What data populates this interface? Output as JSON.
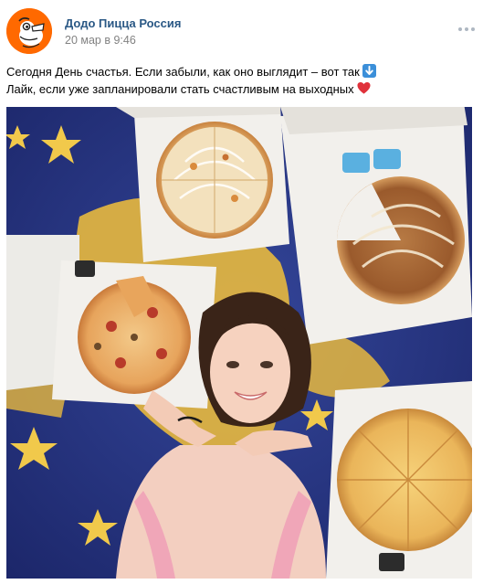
{
  "post": {
    "author": "Додо Пицца Россия",
    "date": "20 мар в 9:46",
    "text_line_1": "Сегодня День счастья. Если забыли, как оно выглядит – вот так",
    "text_line_2": "Лайк, если уже запланировали стать счастливым на выходных",
    "emoji_1": "arrow-down-emoji",
    "emoji_2": "heart-emoji"
  },
  "colors": {
    "author_link": "#2a5885",
    "date": "#828282",
    "avatar_bg": "#ff6900",
    "emoji_blue": "#3b8fd9",
    "heart": "#e0323b"
  }
}
